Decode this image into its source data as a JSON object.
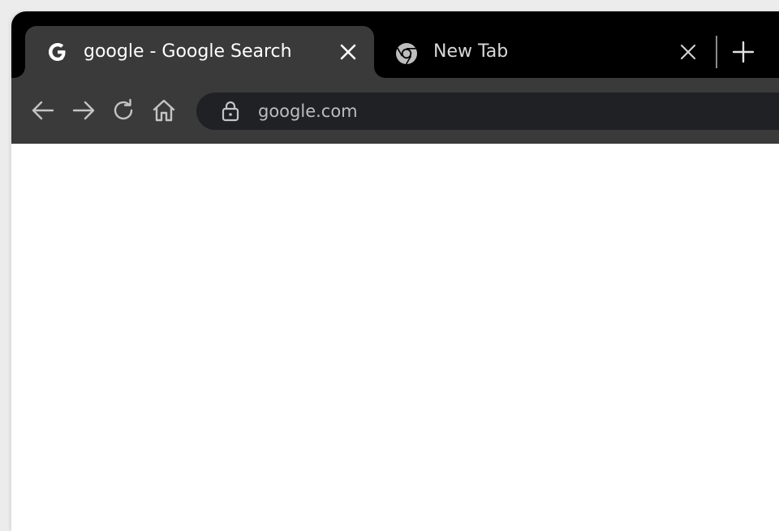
{
  "browser": {
    "tabs": [
      {
        "title": "google - Google Search",
        "favicon": "google-g-icon",
        "active": true
      },
      {
        "title": "New Tab",
        "favicon": "chrome-icon",
        "active": false
      }
    ],
    "toolbar": {
      "back": "arrow-left-icon",
      "forward": "arrow-right-icon",
      "reload": "reload-icon",
      "home": "home-icon"
    },
    "address_bar": {
      "url": "google.com",
      "security_icon": "lock-icon"
    }
  },
  "colors": {
    "tabstrip": "#000000",
    "active_tab": "#3a3a3a",
    "omnibox": "#202124",
    "content": "#ffffff"
  }
}
